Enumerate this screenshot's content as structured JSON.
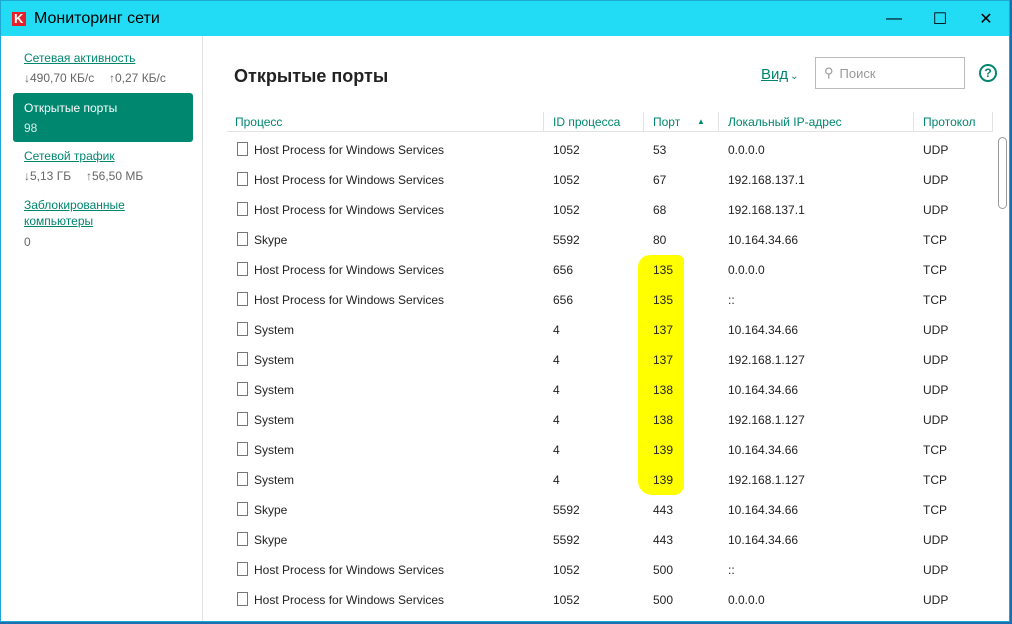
{
  "window": {
    "title": "Мониторинг сети",
    "controls": [
      "—",
      "☐",
      "✕"
    ]
  },
  "sidebar": {
    "activity": {
      "label": "Сетевая активность",
      "down": "↓490,70 КБ/с",
      "up": "↑0,27 КБ/с"
    },
    "ports": {
      "label": "Открытые порты",
      "count": "98"
    },
    "traffic": {
      "label": "Сетевой трафик",
      "down": "↓5,13 ГБ",
      "up": "↑56,50 МБ"
    },
    "blocked": {
      "label1": "Заблокированные",
      "label2": "компьютеры",
      "count": "0"
    }
  },
  "main": {
    "title": "Открытые порты",
    "view": "Вид",
    "search_placeholder": "Поиск",
    "help": "?",
    "columns": [
      "Процесс",
      "ID процесса",
      "Порт",
      "Локальный IP-адрес",
      "Протокол"
    ],
    "rows": [
      [
        "Host Process for Windows Services",
        "1052",
        "53",
        "0.0.0.0",
        "UDP"
      ],
      [
        "Host Process for Windows Services",
        "1052",
        "67",
        "192.168.137.1",
        "UDP"
      ],
      [
        "Host Process for Windows Services",
        "1052",
        "68",
        "192.168.137.1",
        "UDP"
      ],
      [
        "Skype",
        "5592",
        "80",
        "10.164.34.66",
        "TCP"
      ],
      [
        "Host Process for Windows Services",
        "656",
        "135",
        "0.0.0.0",
        "TCP"
      ],
      [
        "Host Process for Windows Services",
        "656",
        "135",
        "::",
        "TCP"
      ],
      [
        "System",
        "4",
        "137",
        "10.164.34.66",
        "UDP"
      ],
      [
        "System",
        "4",
        "137",
        "192.168.1.127",
        "UDP"
      ],
      [
        "System",
        "4",
        "138",
        "10.164.34.66",
        "UDP"
      ],
      [
        "System",
        "4",
        "138",
        "192.168.1.127",
        "UDP"
      ],
      [
        "System",
        "4",
        "139",
        "10.164.34.66",
        "TCP"
      ],
      [
        "System",
        "4",
        "139",
        "192.168.1.127",
        "TCP"
      ],
      [
        "Skype",
        "5592",
        "443",
        "10.164.34.66",
        "TCP"
      ],
      [
        "Skype",
        "5592",
        "443",
        "10.164.34.66",
        "UDP"
      ],
      [
        "Host Process for Windows Services",
        "1052",
        "500",
        "::",
        "UDP"
      ],
      [
        "Host Process for Windows Services",
        "1052",
        "500",
        "0.0.0.0",
        "UDP"
      ]
    ]
  }
}
